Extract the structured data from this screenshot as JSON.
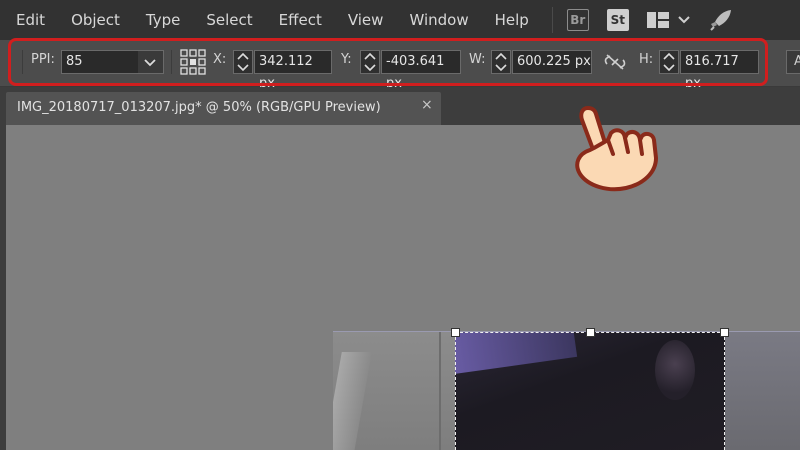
{
  "menu": {
    "items": [
      "Edit",
      "Object",
      "Type",
      "Select",
      "Effect",
      "View",
      "Window",
      "Help"
    ],
    "badges": [
      "Br",
      "St"
    ]
  },
  "control_bar": {
    "ppi_label": "PPI:",
    "ppi_value": "85",
    "x_label": "X:",
    "x_value": "342.112 px",
    "y_label": "Y:",
    "y_value": "-403.641 px",
    "w_label": "W:",
    "w_value": "600.225 px",
    "h_label": "H:",
    "h_value": "816.717 px",
    "right_button_label": "A"
  },
  "tab": {
    "title": "IMG_20180717_013207.jpg* @ 50% (RGB/GPU Preview)",
    "close": "×"
  },
  "colors": {
    "highlight": "#d11e1e",
    "menubar": "#323232",
    "canvas": "#7f7f7f"
  }
}
